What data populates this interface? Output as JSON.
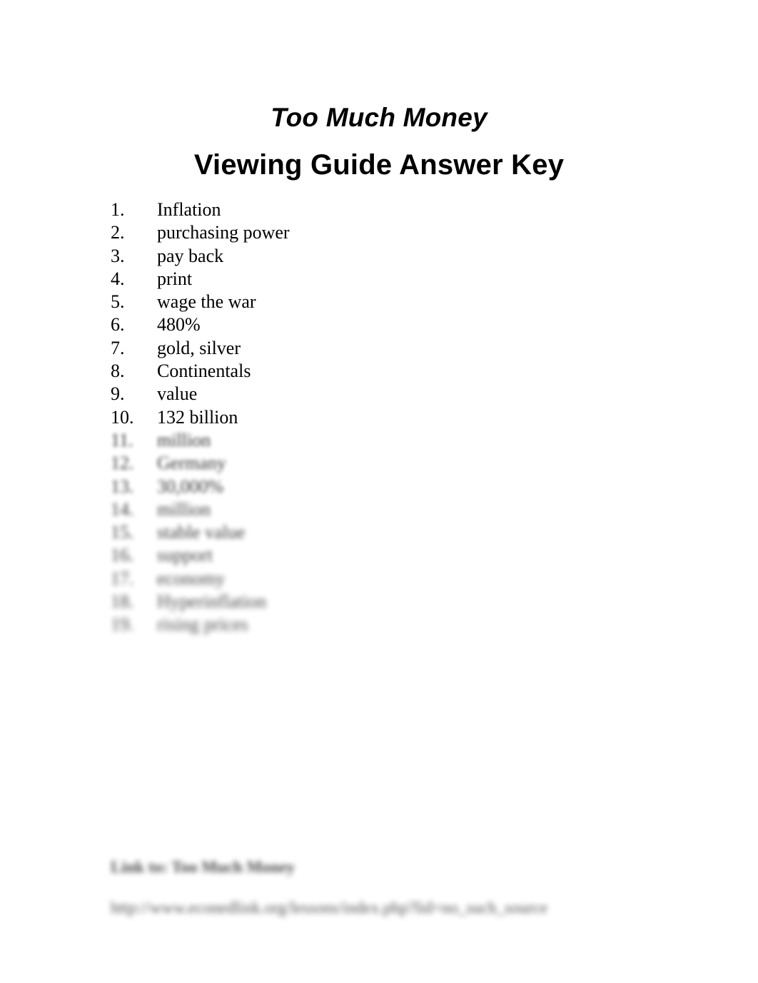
{
  "document": {
    "title": "Too Much Money",
    "subtitle": "Viewing Guide Answer Key",
    "background_color": "#ffffff",
    "text_color": "#000000"
  },
  "answers": [
    {
      "number": "1.",
      "text": "Inflation",
      "obscured": false
    },
    {
      "number": "2.",
      "text": "purchasing power",
      "obscured": false
    },
    {
      "number": "3.",
      "text": "pay back",
      "obscured": false
    },
    {
      "number": "4.",
      "text": "print",
      "obscured": false
    },
    {
      "number": "5.",
      "text": "wage the war",
      "obscured": false
    },
    {
      "number": "6.",
      "text": "480%",
      "obscured": false
    },
    {
      "number": "7.",
      "text": "gold, silver",
      "obscured": false
    },
    {
      "number": "8.",
      "text": "Continentals",
      "obscured": false
    },
    {
      "number": "9.",
      "text": "value",
      "obscured": false
    },
    {
      "number": "10.",
      "text": "132 billion",
      "obscured": false
    },
    {
      "number": "11.",
      "text": "million",
      "obscured": true
    },
    {
      "number": "12.",
      "text": "Germany",
      "obscured": true
    },
    {
      "number": "13.",
      "text": "30,000%",
      "obscured": true
    },
    {
      "number": "14.",
      "text": "million",
      "obscured": true
    },
    {
      "number": "15.",
      "text": "stable value",
      "obscured": true
    },
    {
      "number": "16.",
      "text": "support",
      "obscured": true
    },
    {
      "number": "17.",
      "text": "economy",
      "obscured": true
    },
    {
      "number": "18.",
      "text": "Hyperinflation",
      "obscured": true
    },
    {
      "number": "19.",
      "text": "rising prices",
      "obscured": true
    }
  ],
  "footer": {
    "credit": "Link to: Too Much Money",
    "link": "http://www.econedlink.org/lessons/index.php?lid=no_such_source"
  }
}
